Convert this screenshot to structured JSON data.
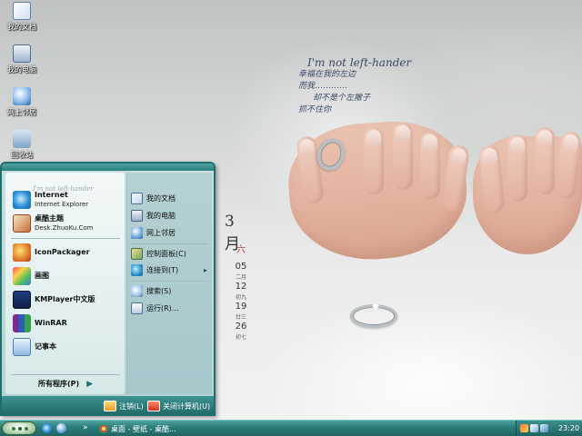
{
  "desktop": {
    "icons": [
      {
        "label": "我的文档",
        "icon": "my-documents-icon"
      },
      {
        "label": "我的电脑",
        "icon": "my-computer-icon"
      },
      {
        "label": "网上邻居",
        "icon": "network-places-icon"
      },
      {
        "label": "回收站",
        "icon": "recycle-bin-icon"
      }
    ]
  },
  "wallpaper": {
    "poem_title": "I'm not left-hander",
    "poem_lines": [
      "幸福在我的左边",
      "而我…………",
      "却不是个左撇子",
      "抓不住你"
    ],
    "calendar": {
      "month": "3月",
      "cells": [
        "六",
        "05",
        "12",
        "19",
        "26"
      ],
      "sub": [
        "",
        "二月",
        "初九",
        "廿三",
        "初七"
      ]
    }
  },
  "start_menu": {
    "watermark": "I'm not left-hander",
    "pinned": [
      {
        "title": "Internet",
        "subtitle": "Internet Explorer",
        "icon": "internet-explorer-icon"
      },
      {
        "title": "桌酷主题",
        "subtitle": "Desk.ZhuoKu.Com",
        "icon": "zhuoku-theme-icon"
      }
    ],
    "recent": [
      {
        "title": "IconPackager",
        "icon": "iconpackager-icon"
      },
      {
        "title": "画图",
        "icon": "paint-icon"
      },
      {
        "title": "KMPlayer中文版",
        "icon": "kmplayer-icon"
      },
      {
        "title": "WinRAR",
        "icon": "winrar-icon"
      },
      {
        "title": "记事本",
        "icon": "notepad-icon"
      }
    ],
    "all_programs": "所有程序(P)",
    "places": [
      {
        "label": "我的文档",
        "icon": "my-documents-icon"
      },
      {
        "label": "我的电脑",
        "icon": "my-computer-icon"
      },
      {
        "label": "网上邻居",
        "icon": "network-places-icon"
      }
    ],
    "system": [
      {
        "label": "控制面板(C)",
        "icon": "control-panel-icon"
      },
      {
        "label": "连接到(T)",
        "icon": "connect-to-icon",
        "submenu": true
      }
    ],
    "tools": [
      {
        "label": "搜索(S)",
        "icon": "search-icon"
      },
      {
        "label": "运行(R)...",
        "icon": "run-icon"
      }
    ],
    "logoff": "注销(L)",
    "shutdown": "关闭计算机(U)"
  },
  "taskbar": {
    "task_label": "桌面 - 壁纸 - 桌酷...",
    "clock": "23:20",
    "more_glyph": "»"
  },
  "colors": {
    "accent": "#1f6e6e",
    "taskbar": "#2b7c79"
  }
}
